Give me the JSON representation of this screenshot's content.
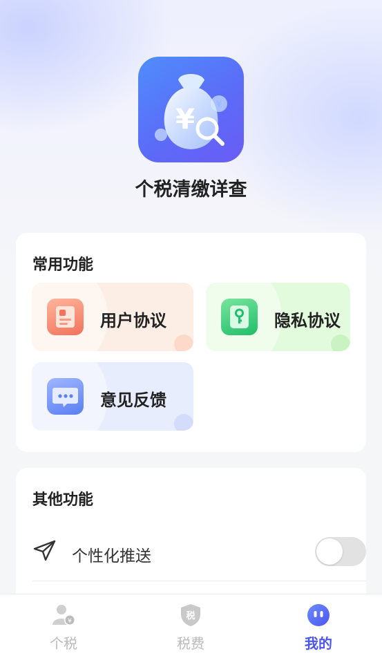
{
  "app": {
    "name": "个税清缴详查",
    "logo_icon": "money-bag-search-icon"
  },
  "common": {
    "title": "常用功能",
    "tiles": [
      {
        "label": "用户协议",
        "icon": "user-agreement-icon"
      },
      {
        "label": "隐私协议",
        "icon": "privacy-key-icon"
      },
      {
        "label": "意见反馈",
        "icon": "feedback-chat-icon"
      }
    ]
  },
  "other": {
    "title": "其他功能",
    "rows": [
      {
        "label": "个性化推送",
        "icon": "send-icon",
        "toggle_on": false
      }
    ]
  },
  "tabbar": {
    "tabs": [
      {
        "label": "个税",
        "icon": "person-tax-icon",
        "active": false
      },
      {
        "label": "税费",
        "icon": "tax-shield-icon",
        "active": false
      },
      {
        "label": "我的",
        "icon": "mine-face-icon",
        "active": true
      }
    ],
    "active_color": "#4c55f0",
    "inactive_color": "#b9b9b9"
  }
}
